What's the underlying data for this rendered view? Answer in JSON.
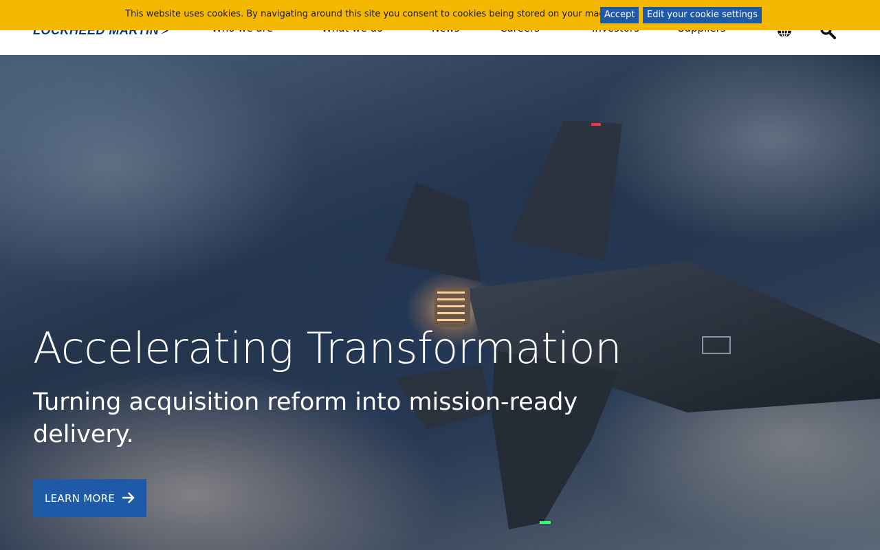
{
  "cookie_banner": {
    "message": "This website uses cookies. By navigating around this site you consent to cookies being stored on your machine.",
    "accept_label": "Accept",
    "settings_label": "Edit your cookie settings"
  },
  "header": {
    "logo_text": "LOCKHEED MARTIN",
    "nav": [
      {
        "label": "Who we are",
        "has_dropdown": true
      },
      {
        "label": "What we do",
        "has_dropdown": true
      },
      {
        "label": "News",
        "has_dropdown": false
      },
      {
        "label": "Careers",
        "has_dropdown": true
      },
      {
        "label": "Investors",
        "has_dropdown": false
      },
      {
        "label": "Suppliers",
        "has_dropdown": false
      }
    ],
    "icons": [
      "globe-icon",
      "search-icon"
    ]
  },
  "hero": {
    "title": "Accelerating Transformation",
    "subtitle": "Turning acquisition reform into mission-ready delivery.",
    "cta_label": "LEARN MORE",
    "cta_icon": "arrow-right-icon"
  },
  "colors": {
    "cookie_bar": "#f5b800",
    "button_blue": "#1e5aa8",
    "logo_blue": "#0b3a7a"
  }
}
